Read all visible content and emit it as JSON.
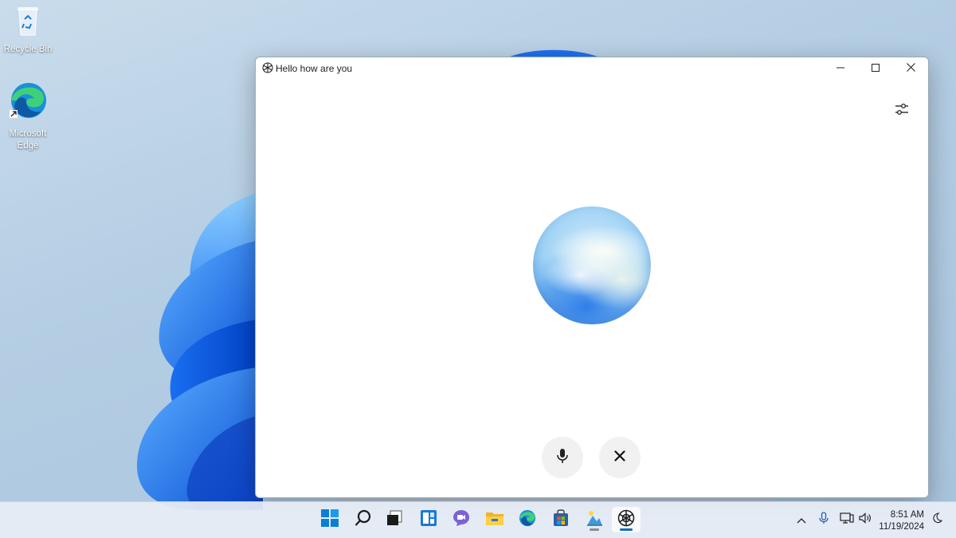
{
  "desktop": {
    "icons": [
      {
        "label": "Recycle Bin",
        "icon": "recycle-bin-icon"
      },
      {
        "label": "Microsoft Edge",
        "icon": "edge-icon"
      }
    ]
  },
  "window": {
    "title": "Hello how are you",
    "app_icon": "chatgpt-icon",
    "controls": [
      "minimize-icon",
      "maximize-icon",
      "close-icon"
    ],
    "settings_icon": "sliders-icon",
    "orb": "voice-orb",
    "buttons": [
      {
        "name": "microphone-button",
        "icon": "microphone-icon"
      },
      {
        "name": "end-voice-button",
        "icon": "close-icon"
      }
    ]
  },
  "taskbar": {
    "apps": [
      "start-icon",
      "search-icon",
      "task-view-icon",
      "widgets-icon",
      "chat-icon",
      "file-explorer-icon",
      "edge-icon",
      "store-icon",
      "photos-icon",
      "chatgpt-icon"
    ],
    "active_app": "chatgpt-icon",
    "tray": [
      "chevron-up-icon",
      "microphone-icon",
      "network-icon",
      "volume-icon"
    ],
    "time": "8:51 AM",
    "date": "11/19/2024",
    "accent_color": "#0f6cbd"
  }
}
